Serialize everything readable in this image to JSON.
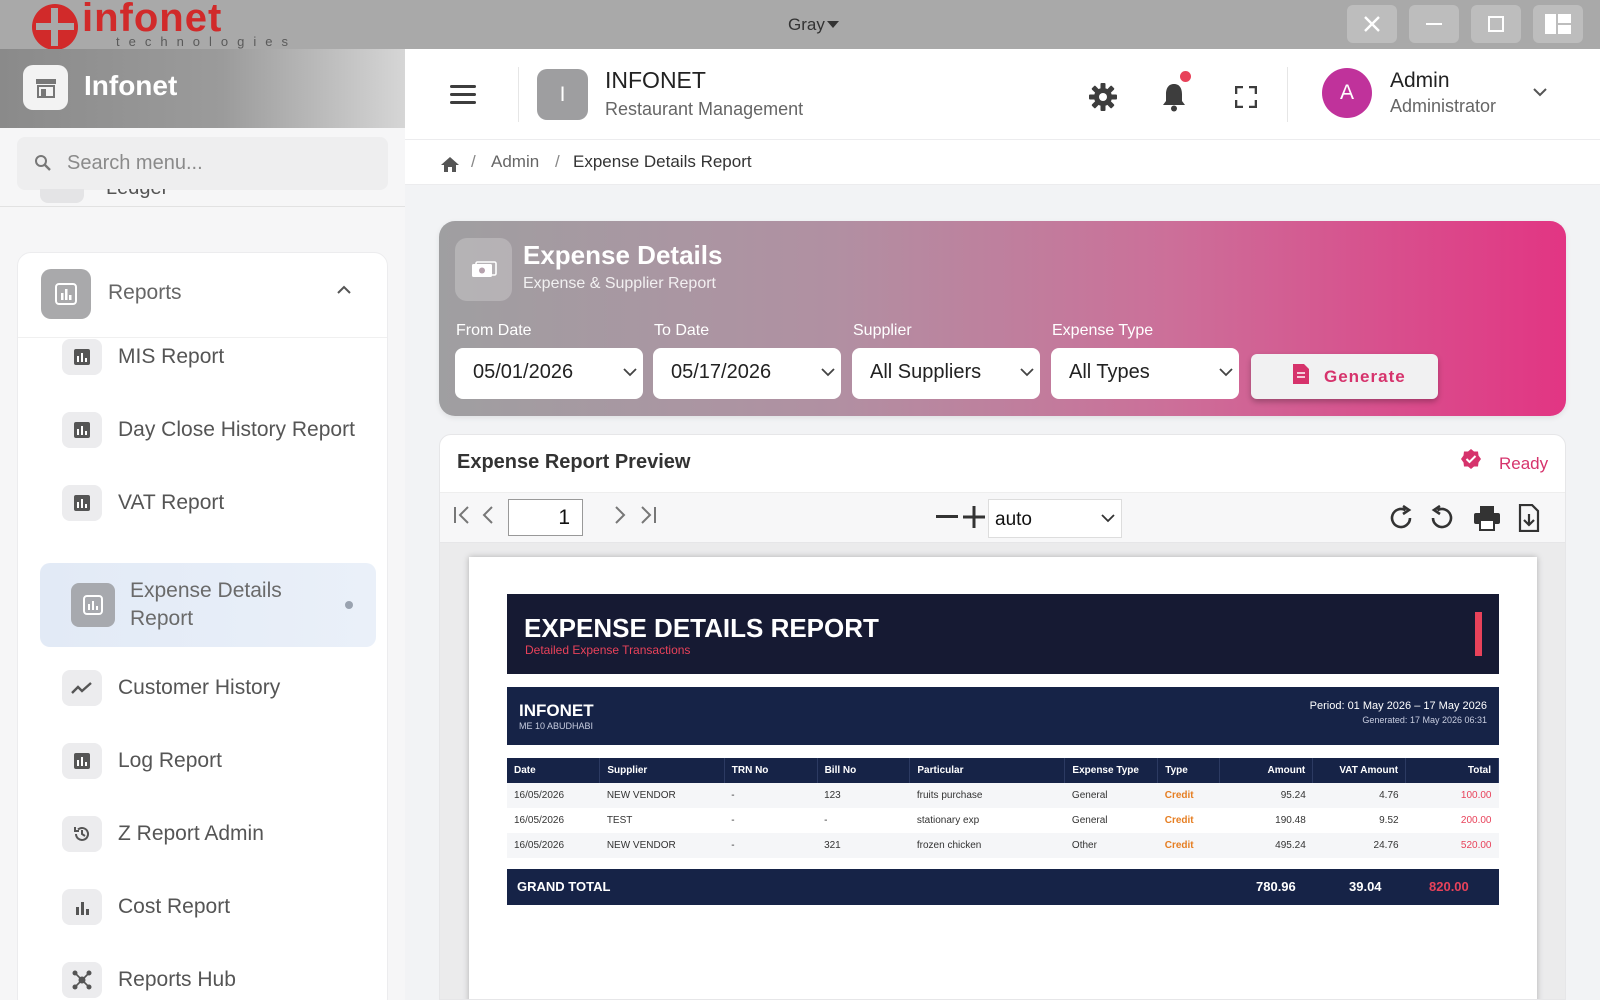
{
  "os": {
    "logo_text": "infonet",
    "logo_sub": "technologies",
    "theme_label": "Gray"
  },
  "sidebar": {
    "brand": "Infonet",
    "search_placeholder": "Search menu...",
    "peek_item": "Ledger",
    "section_title": "Reports",
    "items": [
      {
        "label": "MIS Report",
        "icon": "chart-icon"
      },
      {
        "label": "Day Close History Report",
        "icon": "chart-icon"
      },
      {
        "label": "VAT Report",
        "icon": "chart-icon"
      },
      {
        "label": "Expense Details Report",
        "icon": "chart-icon",
        "active": true
      },
      {
        "label": "Customer History",
        "icon": "trend-icon"
      },
      {
        "label": "Log Report",
        "icon": "chart-icon"
      },
      {
        "label": "Z Report Admin",
        "icon": "history-icon"
      },
      {
        "label": "Cost Report",
        "icon": "bar-chart-icon"
      },
      {
        "label": "Reports Hub",
        "icon": "hub-icon"
      }
    ]
  },
  "header": {
    "app_badge": "I",
    "app_title": "INFONET",
    "app_subtitle": "Restaurant Management",
    "user_initial": "A",
    "user_name": "Admin",
    "user_role": "Administrator"
  },
  "breadcrumb": {
    "items": [
      "Admin",
      "Expense Details Report"
    ]
  },
  "filters": {
    "title": "Expense Details",
    "subtitle": "Expense & Supplier Report",
    "from_label": "From Date",
    "from_value": "05/01/2026",
    "to_label": "To Date",
    "to_value": "05/17/2026",
    "supplier_label": "Supplier",
    "supplier_value": "All Suppliers",
    "type_label": "Expense Type",
    "type_value": "All Types",
    "generate_label": "Generate"
  },
  "preview": {
    "title": "Expense Report Preview",
    "status": "Ready",
    "page": "1",
    "zoom": "auto"
  },
  "report": {
    "title": "EXPENSE DETAILS REPORT",
    "subtitle": "Detailed Expense Transactions",
    "company": "INFONET",
    "address": "ME 10 ABUDHABI",
    "period": "Period: 01 May 2026 – 17 May 2026",
    "generated": "Generated: 17 May 2026 06:31",
    "columns": [
      "Date",
      "Supplier",
      "TRN No",
      "Bill No",
      "Particular",
      "Expense Type",
      "Type",
      "Amount",
      "VAT Amount",
      "Total"
    ],
    "rows": [
      [
        "16/05/2026",
        "NEW VENDOR",
        "-",
        "123",
        "fruits purchase",
        "General",
        "Credit",
        "95.24",
        "4.76",
        "100.00"
      ],
      [
        "16/05/2026",
        "TEST",
        "-",
        "-",
        "stationary exp",
        "General",
        "Credit",
        "190.48",
        "9.52",
        "200.00"
      ],
      [
        "16/05/2026",
        "NEW VENDOR",
        "-",
        "321",
        "frozen chicken",
        "Other",
        "Credit",
        "495.24",
        "24.76",
        "520.00"
      ]
    ],
    "grand_total_label": "GRAND TOTAL",
    "grand_amount": "780.96",
    "grand_vat": "39.04",
    "grand_total": "820.00"
  }
}
